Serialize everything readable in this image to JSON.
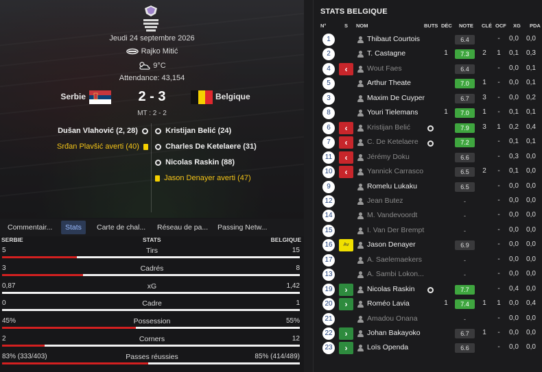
{
  "match": {
    "date": "Jeudi 24 septembre 2026",
    "referee": "Rajko Mitić",
    "weather": "9°C",
    "attendance": "Attendance: 43,154",
    "home": "Serbie",
    "away": "Belgique",
    "score": "2 - 3",
    "halftime": "MT : 2 - 2"
  },
  "events": {
    "home": [
      {
        "text": "Dušan Vlahović (2, 28)",
        "type": "goal"
      },
      {
        "text": "Srđan Plavšić averti (40)",
        "type": "yellow"
      }
    ],
    "away": [
      {
        "text": "Kristijan Belić (24)",
        "type": "goal"
      },
      {
        "text": "Charles De Ketelaere (31)",
        "type": "goal"
      },
      {
        "text": "Nicolas Raskin (88)",
        "type": "goal"
      },
      {
        "text": "Jason Denayer averti (47)",
        "type": "yellow"
      }
    ]
  },
  "tabs": [
    "Commentair...",
    "Stats",
    "Carte de chal...",
    "Réseau de pa...",
    "Passing Netw..."
  ],
  "stats_header": {
    "home": "SERBIE",
    "title": "STATS",
    "away": "BELGIQUE"
  },
  "stats": [
    {
      "label": "Tirs",
      "home": "5",
      "away": "15",
      "share": 0.25
    },
    {
      "label": "Cadrés",
      "home": "3",
      "away": "8",
      "share": 0.273
    },
    {
      "label": "xG",
      "home": "0,87",
      "away": "1,42",
      "share": 0.0
    },
    {
      "label": "Cadre",
      "home": "0",
      "away": "1",
      "share": 0.0
    },
    {
      "label": "Possession",
      "home": "45%",
      "away": "55%",
      "share": 0.45
    },
    {
      "label": "Corners",
      "home": "2",
      "away": "12",
      "share": 0.143
    },
    {
      "label": "Passes réussies",
      "home": "83% (333/403)",
      "away": "85% (414/489)",
      "share": 0.49
    }
  ],
  "right_title": "STATS BELGIQUE",
  "columns": [
    "N°",
    "S",
    "NOM",
    "BUTS",
    "DÉC",
    "NOTE",
    "CLÉ",
    "OCF",
    "XG",
    "PDA"
  ],
  "players": [
    {
      "num": "1",
      "sub": "",
      "name": "Thibaut Courtois",
      "dim": false,
      "goal": false,
      "buts": "",
      "dec": "",
      "note": "6.4",
      "good": false,
      "cle": "",
      "ocf": "-",
      "xg": "0,0",
      "pda": "0,0"
    },
    {
      "num": "2",
      "sub": "",
      "name": "T. Castagne",
      "dim": false,
      "goal": false,
      "buts": "",
      "dec": "1",
      "note": "7.3",
      "good": true,
      "cle": "2",
      "ocf": "1",
      "xg": "0,1",
      "pda": "0,3"
    },
    {
      "num": "4",
      "sub": "out",
      "name": "Wout Faes",
      "dim": true,
      "goal": false,
      "buts": "",
      "dec": "",
      "note": "6.4",
      "good": false,
      "cle": "",
      "ocf": "-",
      "xg": "0,0",
      "pda": "0,1"
    },
    {
      "num": "5",
      "sub": "",
      "name": "Arthur Theate",
      "dim": false,
      "goal": false,
      "buts": "",
      "dec": "",
      "note": "7.0",
      "good": true,
      "cle": "1",
      "ocf": "-",
      "xg": "0,0",
      "pda": "0,1"
    },
    {
      "num": "3",
      "sub": "",
      "name": "Maxim De Cuyper",
      "dim": false,
      "goal": false,
      "buts": "",
      "dec": "",
      "note": "6.7",
      "good": false,
      "cle": "3",
      "ocf": "-",
      "xg": "0,0",
      "pda": "0,2"
    },
    {
      "num": "8",
      "sub": "",
      "name": "Youri Tielemans",
      "dim": false,
      "goal": false,
      "buts": "",
      "dec": "1",
      "note": "7.0",
      "good": true,
      "cle": "1",
      "ocf": "-",
      "xg": "0,1",
      "pda": "0,1"
    },
    {
      "num": "6",
      "sub": "out",
      "name": "Kristijan Belić",
      "dim": true,
      "goal": true,
      "buts": "",
      "dec": "",
      "note": "7.9",
      "good": true,
      "cle": "3",
      "ocf": "1",
      "xg": "0,2",
      "pda": "0,4"
    },
    {
      "num": "7",
      "sub": "out",
      "name": "C. De Ketelaere",
      "dim": true,
      "goal": true,
      "buts": "",
      "dec": "",
      "note": "7.2",
      "good": true,
      "cle": "",
      "ocf": "-",
      "xg": "0,1",
      "pda": "0,1"
    },
    {
      "num": "11",
      "sub": "out",
      "name": "Jérémy Doku",
      "dim": true,
      "goal": false,
      "buts": "",
      "dec": "",
      "note": "6.6",
      "good": false,
      "cle": "",
      "ocf": "-",
      "xg": "0,3",
      "pda": "0,0"
    },
    {
      "num": "10",
      "sub": "out",
      "name": "Yannick Carrasco",
      "dim": true,
      "goal": false,
      "buts": "",
      "dec": "",
      "note": "6.5",
      "good": false,
      "cle": "2",
      "ocf": "-",
      "xg": "0,1",
      "pda": "0,0"
    },
    {
      "num": "9",
      "sub": "",
      "name": "Romelu Lukaku",
      "dim": false,
      "goal": false,
      "buts": "",
      "dec": "",
      "note": "6.5",
      "good": false,
      "cle": "",
      "ocf": "-",
      "xg": "0,0",
      "pda": "0,0"
    },
    {
      "num": "12",
      "sub": "",
      "name": "Jean Butez",
      "dim": true,
      "goal": false,
      "buts": "",
      "dec": "",
      "note": "-",
      "good": false,
      "cle": "",
      "ocf": "-",
      "xg": "0,0",
      "pda": "0,0"
    },
    {
      "num": "14",
      "sub": "",
      "name": "M. Vandevoordt",
      "dim": true,
      "goal": false,
      "buts": "",
      "dec": "",
      "note": "-",
      "good": false,
      "cle": "",
      "ocf": "-",
      "xg": "0,0",
      "pda": "0,0"
    },
    {
      "num": "15",
      "sub": "",
      "name": "I. Van Der Brempt",
      "dim": true,
      "goal": false,
      "buts": "",
      "dec": "",
      "note": "-",
      "good": false,
      "cle": "",
      "ocf": "-",
      "xg": "0,0",
      "pda": "0,0"
    },
    {
      "num": "16",
      "sub": "yel",
      "name": "Jason Denayer",
      "dim": false,
      "goal": false,
      "buts": "",
      "dec": "",
      "note": "6.9",
      "good": false,
      "cle": "",
      "ocf": "-",
      "xg": "0,0",
      "pda": "0,0"
    },
    {
      "num": "17",
      "sub": "",
      "name": "A. Saelemaekers",
      "dim": true,
      "goal": false,
      "buts": "",
      "dec": "",
      "note": "-",
      "good": false,
      "cle": "",
      "ocf": "-",
      "xg": "0,0",
      "pda": "0,0"
    },
    {
      "num": "13",
      "sub": "",
      "name": "A. Sambi Lokon...",
      "dim": true,
      "goal": false,
      "buts": "",
      "dec": "",
      "note": "-",
      "good": false,
      "cle": "",
      "ocf": "-",
      "xg": "0,0",
      "pda": "0,0"
    },
    {
      "num": "19",
      "sub": "in",
      "name": "Nicolas Raskin",
      "dim": false,
      "goal": true,
      "buts": "",
      "dec": "",
      "note": "7.7",
      "good": true,
      "cle": "",
      "ocf": "-",
      "xg": "0,4",
      "pda": "0,0"
    },
    {
      "num": "20",
      "sub": "in",
      "name": "Roméo Lavia",
      "dim": false,
      "goal": false,
      "buts": "",
      "dec": "1",
      "note": "7.4",
      "good": true,
      "cle": "1",
      "ocf": "1",
      "xg": "0,0",
      "pda": "0,4"
    },
    {
      "num": "21",
      "sub": "",
      "name": "Amadou Onana",
      "dim": true,
      "goal": false,
      "buts": "",
      "dec": "",
      "note": "-",
      "good": false,
      "cle": "",
      "ocf": "-",
      "xg": "0,0",
      "pda": "0,0"
    },
    {
      "num": "22",
      "sub": "in",
      "name": "Johan Bakayoko",
      "dim": false,
      "goal": false,
      "buts": "",
      "dec": "",
      "note": "6.7",
      "good": false,
      "cle": "1",
      "ocf": "-",
      "xg": "0,0",
      "pda": "0,0"
    },
    {
      "num": "23",
      "sub": "in",
      "name": "Loïs Openda",
      "dim": false,
      "goal": false,
      "buts": "",
      "dec": "",
      "note": "6.6",
      "good": false,
      "cle": "",
      "ocf": "-",
      "xg": "0,0",
      "pda": "0,0"
    }
  ],
  "colors": {
    "accent": "#9bbcff",
    "home_bar": "#d42020",
    "good_rating": "#3fa63f",
    "yellow": "#f5c518"
  },
  "icons": {
    "logo": "nations-league-logo",
    "referee": "whistle-icon",
    "weather": "cloud-sun-icon",
    "goal": "ball-icon",
    "sub_out": "chevron-left-icon",
    "sub_in": "chevron-right-icon"
  }
}
